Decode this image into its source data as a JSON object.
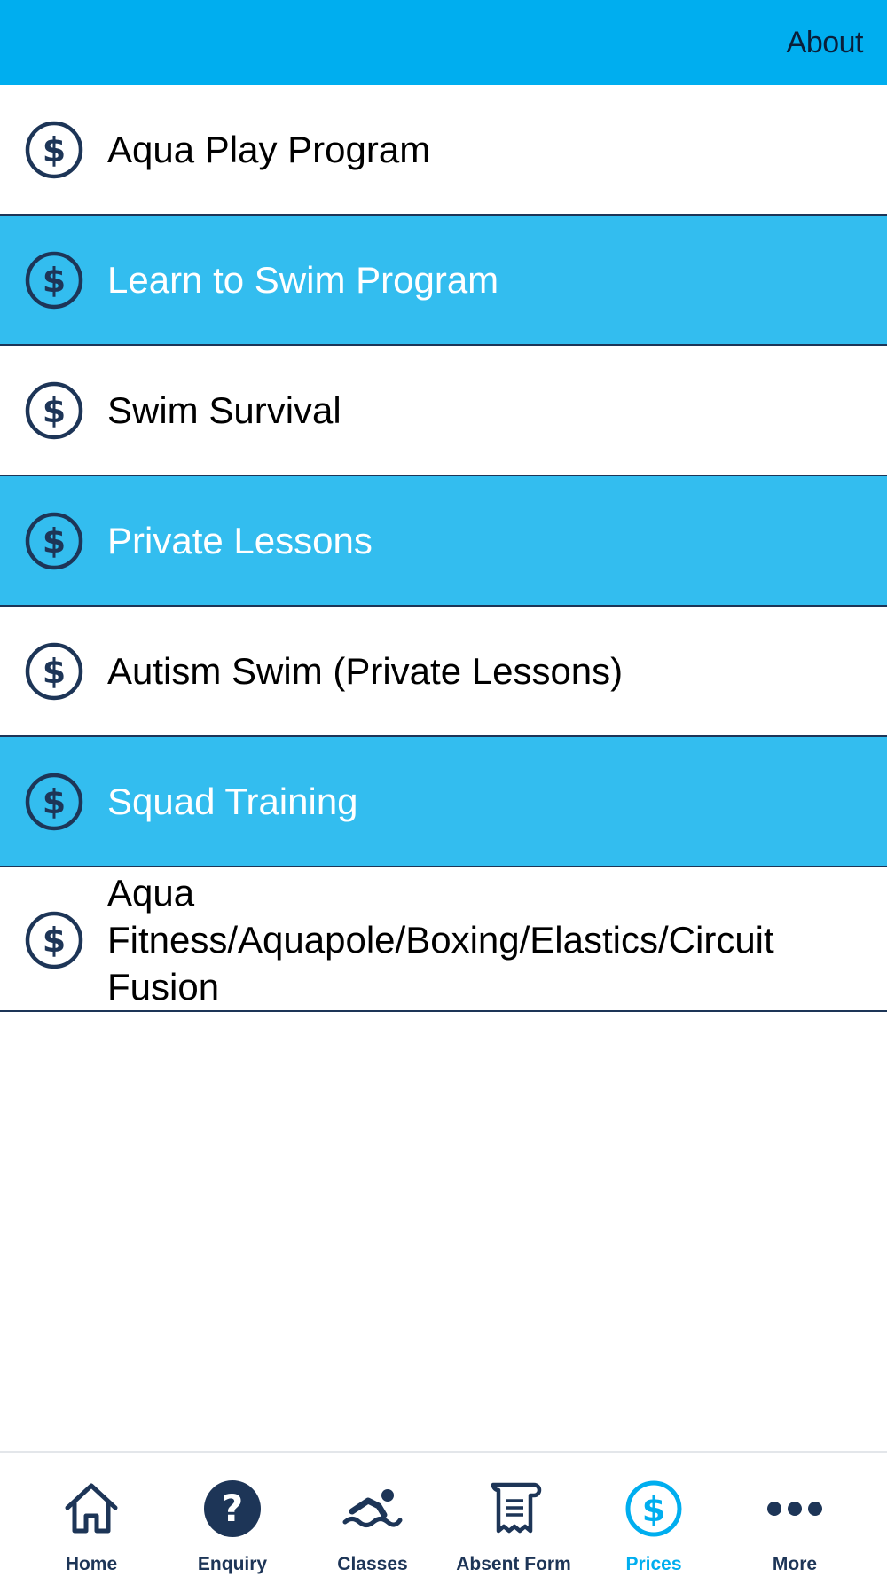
{
  "header": {
    "about_label": "About"
  },
  "price_list": {
    "items": [
      {
        "label": "Aqua Play Program",
        "icon": "dollar-circle-icon",
        "highlighted": false
      },
      {
        "label": "Learn to Swim Program",
        "icon": "dollar-circle-icon",
        "highlighted": true
      },
      {
        "label": "Swim Survival",
        "icon": "dollar-circle-icon",
        "highlighted": false
      },
      {
        "label": "Private Lessons",
        "icon": "dollar-circle-icon",
        "highlighted": true
      },
      {
        "label": "Autism Swim (Private Lessons)",
        "icon": "dollar-circle-icon",
        "highlighted": false
      },
      {
        "label": "Squad Training",
        "icon": "dollar-circle-icon",
        "highlighted": true
      },
      {
        "label": "Aqua Fitness/Aquapole/Boxing/Elastics/Circuit Fusion",
        "icon": "dollar-circle-icon",
        "highlighted": false
      }
    ]
  },
  "tab_bar": {
    "tabs": [
      {
        "label": "Home",
        "icon": "home-icon",
        "active": false
      },
      {
        "label": "Enquiry",
        "icon": "question-icon",
        "active": false
      },
      {
        "label": "Classes",
        "icon": "swimmer-icon",
        "active": false
      },
      {
        "label": "Absent Form",
        "icon": "scroll-form-icon",
        "active": false
      },
      {
        "label": "Prices",
        "icon": "dollar-circle-icon",
        "active": true
      },
      {
        "label": "More",
        "icon": "more-dots-icon",
        "active": false
      }
    ]
  },
  "colors": {
    "header_bg": "#00AEEF",
    "highlight_row_bg": "#33BDEF",
    "navy": "#1D3557",
    "active_tab": "#00AEEF",
    "white": "#FFFFFF"
  }
}
